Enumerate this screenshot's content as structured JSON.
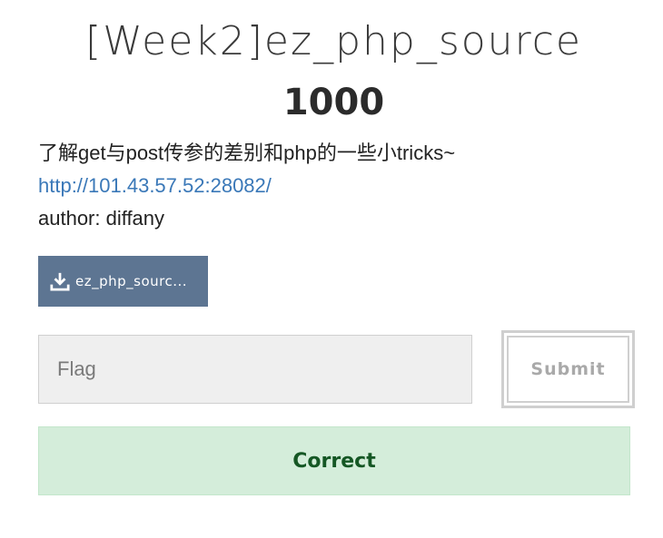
{
  "challenge": {
    "title": "[Week2]ez_php_source",
    "points": "1000",
    "description": "了解get与post传参的差别和php的一些小tricks~",
    "link": "http://101.43.57.52:28082/",
    "author": "author: diffany"
  },
  "download": {
    "icon": "download-icon",
    "label": "ez_php_sourc..."
  },
  "flag_form": {
    "placeholder": "Flag",
    "value": "",
    "submit_label": "Submit"
  },
  "result": {
    "message": "Correct",
    "color": "#155724",
    "background": "#d4edda"
  },
  "colors": {
    "download_button": "#5d7592",
    "link": "#3a78b8"
  }
}
